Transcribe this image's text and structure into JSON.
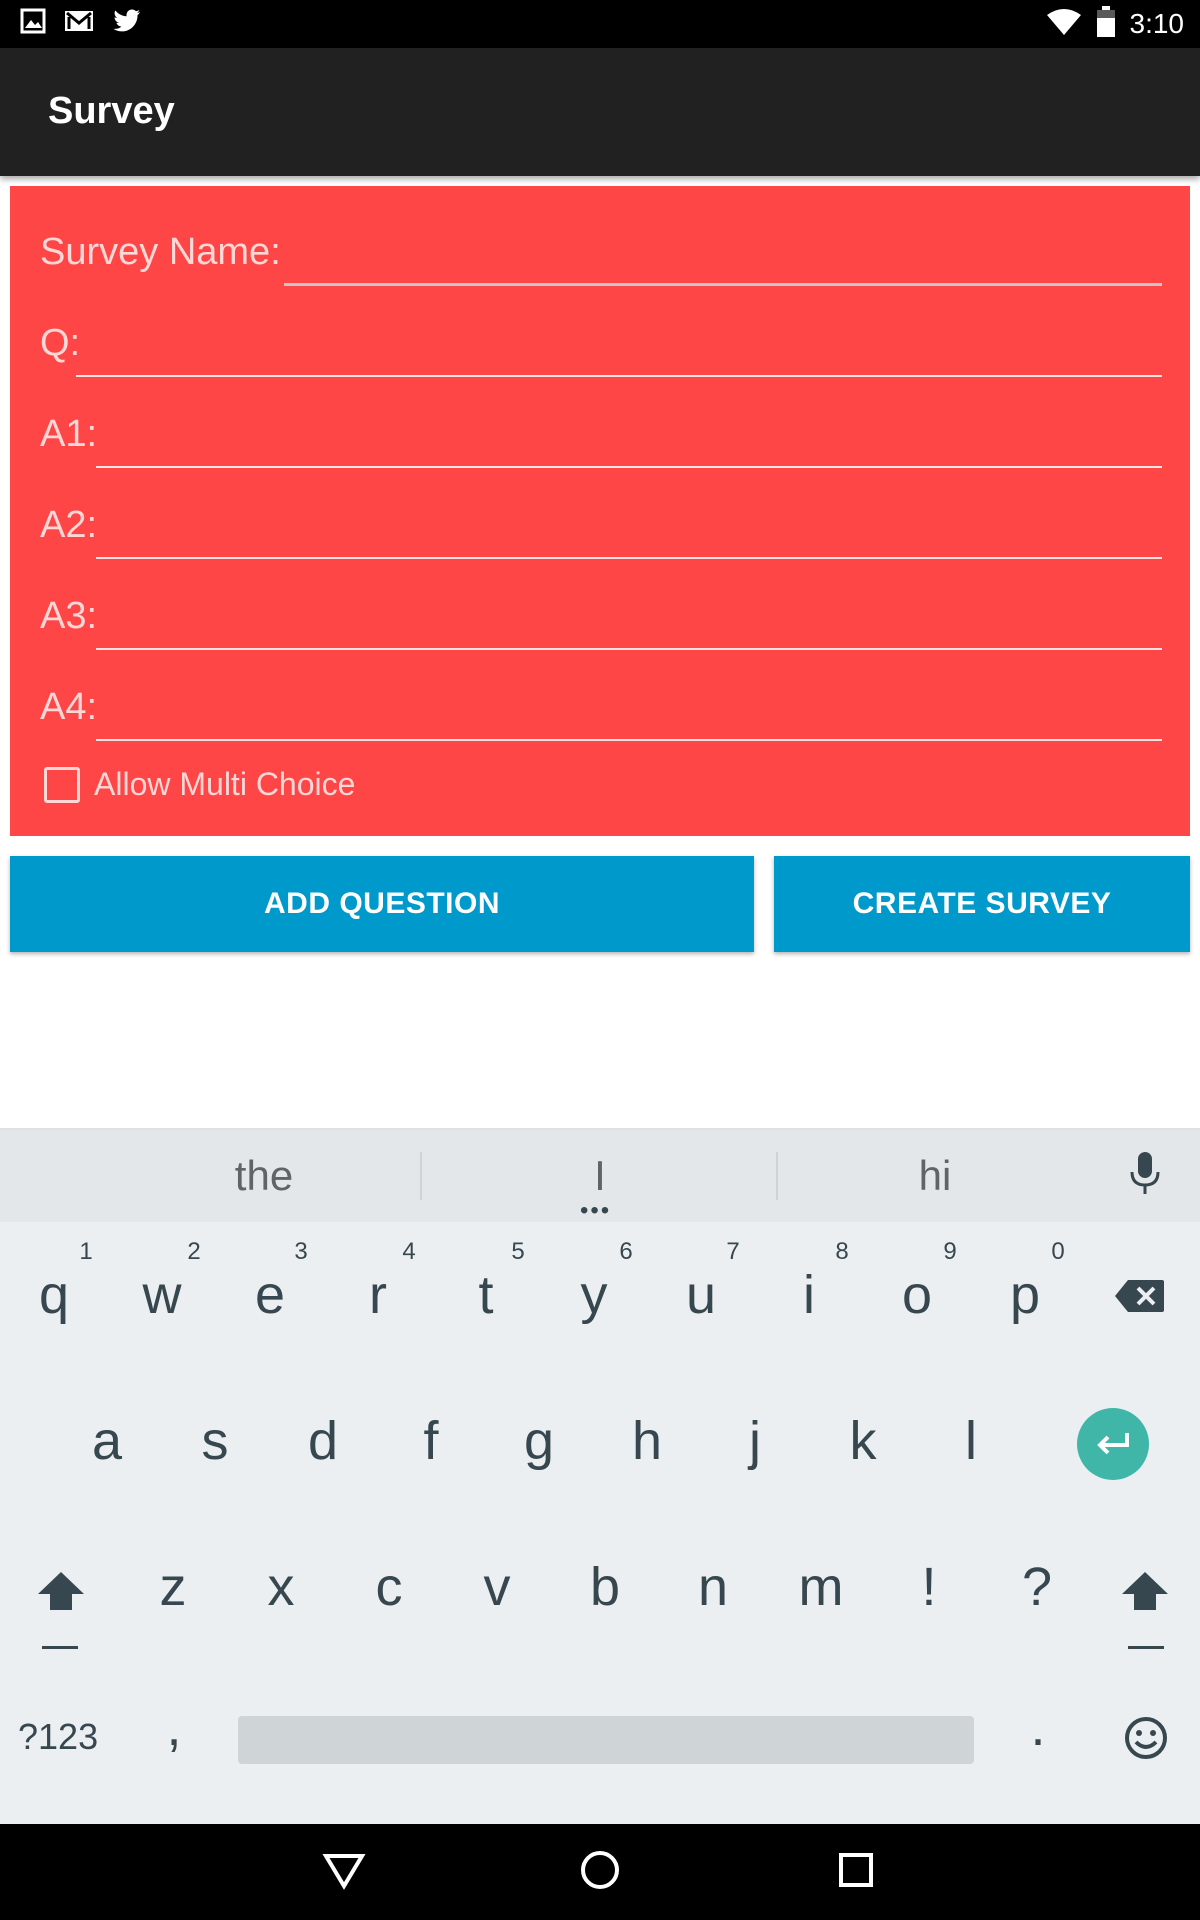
{
  "status_bar": {
    "time": "3:10",
    "icons": [
      "image-icon",
      "gmail-icon",
      "twitter-icon",
      "wifi-icon",
      "battery-icon"
    ]
  },
  "app_bar": {
    "title": "Survey"
  },
  "form": {
    "survey_name_label": "Survey Name:",
    "question_label": "Q:",
    "answers": [
      {
        "label": "A1:"
      },
      {
        "label": "A2:"
      },
      {
        "label": "A3:"
      },
      {
        "label": "A4:"
      }
    ],
    "survey_name_value": "",
    "question_value": "",
    "multi_choice_label": "Allow Multi Choice",
    "multi_choice_checked": false,
    "background_color": "#fe4646"
  },
  "buttons": {
    "add_question": "ADD QUESTION",
    "create_survey": "CREATE SURVEY",
    "color": "#0099cc"
  },
  "keyboard": {
    "suggestions": [
      "the",
      "I",
      "hi"
    ],
    "row1": [
      "q",
      "w",
      "e",
      "r",
      "t",
      "y",
      "u",
      "i",
      "o",
      "p"
    ],
    "row1_hints": [
      "1",
      "2",
      "3",
      "4",
      "5",
      "6",
      "7",
      "8",
      "9",
      "0"
    ],
    "row2": [
      "a",
      "s",
      "d",
      "f",
      "g",
      "h",
      "j",
      "k",
      "l"
    ],
    "row3": [
      "z",
      "x",
      "c",
      "v",
      "b",
      "n",
      "m",
      "!",
      "?"
    ],
    "symbols_key": "?123",
    "comma_key": ",",
    "period_key": ".",
    "enter_color": "#3fb6a8"
  }
}
